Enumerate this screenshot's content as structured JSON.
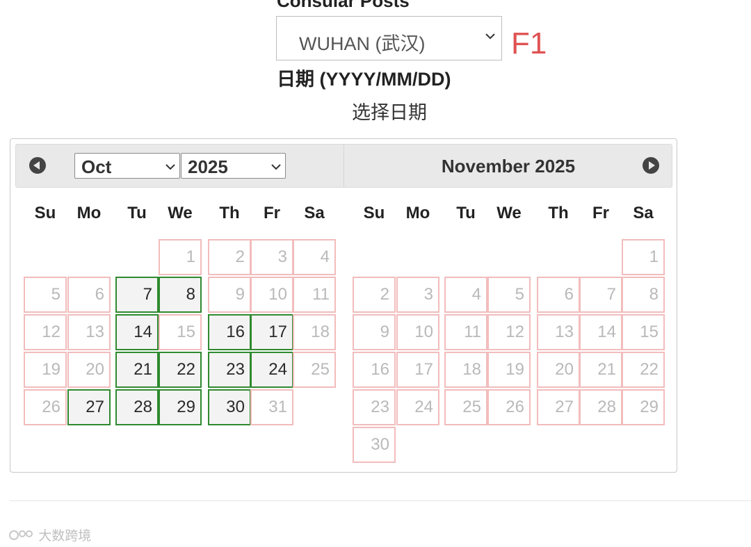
{
  "form": {
    "consular_label": "Consular Posts",
    "post_value": "WUHAN (武汉)",
    "annotation": "F1",
    "date_label": "日期 (YYYY/MM/DD)",
    "pick_label": "选择日期"
  },
  "calendar": {
    "month_select": "Oct",
    "year_select": "2025",
    "right_title": "November 2025",
    "weekdays": [
      "Su",
      "Mo",
      "Tu",
      "We",
      "Th",
      "Fr",
      "Sa"
    ],
    "october": {
      "first_weekday": 3,
      "days": 31,
      "available": [
        7,
        8,
        14,
        16,
        17,
        21,
        22,
        23,
        24,
        27,
        28,
        29,
        30
      ]
    },
    "november": {
      "first_weekday": 6,
      "days": 30,
      "available": []
    }
  },
  "colors": {
    "available_border": "#2f8a2f",
    "unavailable_border": "#f2bcbc",
    "annotation": "#e05252"
  },
  "watermark": "大数跨境"
}
